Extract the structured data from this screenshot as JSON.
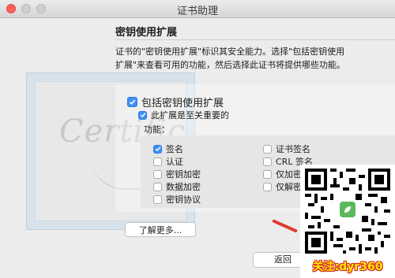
{
  "window": {
    "title": "证书助理"
  },
  "section": {
    "title": "密钥使用扩展",
    "description": "证书的\"密钥使用扩展\"标识其安全能力。选择\"包括密钥使用扩展\"来查看可用的功能，然后选择此证书将提供哪些功能。"
  },
  "options": {
    "include_extension": {
      "label": "包括密钥使用扩展",
      "checked": true
    },
    "critical": {
      "label": "此扩展是至关重要的",
      "checked": true
    },
    "functions_label": "功能：",
    "left_column": [
      {
        "label": "签名",
        "checked": true
      },
      {
        "label": "认证",
        "checked": false
      },
      {
        "label": "密钥加密",
        "checked": false
      },
      {
        "label": "数据加密",
        "checked": false
      },
      {
        "label": "密钥协议",
        "checked": false
      }
    ],
    "right_column": [
      {
        "label": "证书签名",
        "checked": false
      },
      {
        "label": "CRL 签名",
        "checked": false
      },
      {
        "label": "仅加密",
        "checked": false
      },
      {
        "label": "仅解密",
        "checked": false
      }
    ]
  },
  "buttons": {
    "learn_more": "了解更多...",
    "back": "返回"
  },
  "background_art": {
    "script_text": "Certific"
  },
  "watermark": {
    "caption": "关注:dyr360"
  },
  "colors": {
    "accent": "#3d8ff5",
    "close": "#fc605c",
    "caption": "#ffe900",
    "arrow": "#e0392f"
  }
}
